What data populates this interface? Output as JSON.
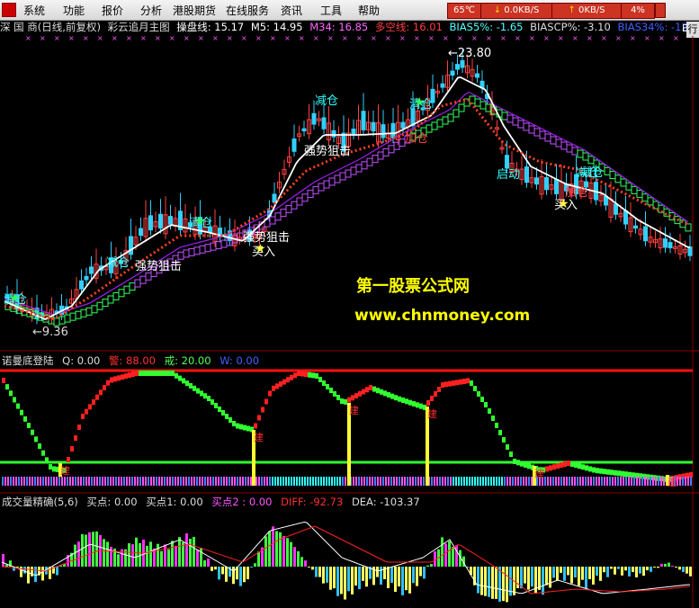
{
  "menu": {
    "items": [
      "系统",
      "功能",
      "报价",
      "分析",
      "港股期货",
      "在线服务",
      "资讯",
      "工具",
      "帮助"
    ],
    "temperature": "65℃",
    "net_down": "0.0KB/S",
    "net_up": "0KB/S",
    "cpu": "4%"
  },
  "main_chart": {
    "title_parts": [
      {
        "text": "深 国 商(日线,前复权)",
        "color": "#dddddd"
      },
      {
        "text": "彩云追月主图",
        "color": "#dddddd"
      },
      {
        "text": "操盘线: 15.17",
        "color": "#ffffff"
      },
      {
        "text": "M5: 14.95",
        "color": "#ffffff"
      },
      {
        "text": "M34: 16.85",
        "color": "#ff66ff"
      },
      {
        "text": "多空线: 16.01",
        "color": "#ff4040"
      },
      {
        "text": "BIAS5%: -1.65",
        "color": "#55ffff"
      },
      {
        "text": "BIASCP%: -3.10",
        "color": "#dddddd"
      },
      {
        "text": "BIAS34%: -12.77",
        "color": "#4060ff"
      }
    ],
    "side_button": "行",
    "side_label": "E",
    "annotations": [
      "清仓",
      "←9.36",
      "减仓",
      "强势狙击",
      "清仓",
      "强势狙击",
      "买入",
      "减仓",
      "强势狙击",
      "清仓",
      "加仓",
      "←23.80",
      "减仓",
      "启动",
      "加仓",
      "买入",
      "减仓"
    ],
    "watermark_title": "第一股票公式网",
    "watermark_url": "www.chnmoney.com"
  },
  "panel2": {
    "title_parts": [
      {
        "text": "诺曼底登陆",
        "color": "#dddddd"
      },
      {
        "text": "Q: 0.00",
        "color": "#dddddd"
      },
      {
        "text": "警: 88.00",
        "color": "#ff3030"
      },
      {
        "text": "戒: 20.00",
        "color": "#55ff55"
      },
      {
        "text": "W: 0.00",
        "color": "#4060ff"
      }
    ],
    "marker_label": "建"
  },
  "panel3": {
    "title_parts": [
      {
        "text": "成交量精确(5,6)",
        "color": "#dddddd"
      },
      {
        "text": "买点: 0.00",
        "color": "#dddddd"
      },
      {
        "text": "买点1: 0.00",
        "color": "#dddddd"
      },
      {
        "text": "买点2 : 0.00",
        "color": "#ff55ff"
      },
      {
        "text": "DIFF: -92.73",
        "color": "#ff3030"
      },
      {
        "text": "DEA: -103.37",
        "color": "#dddddd"
      }
    ]
  }
}
